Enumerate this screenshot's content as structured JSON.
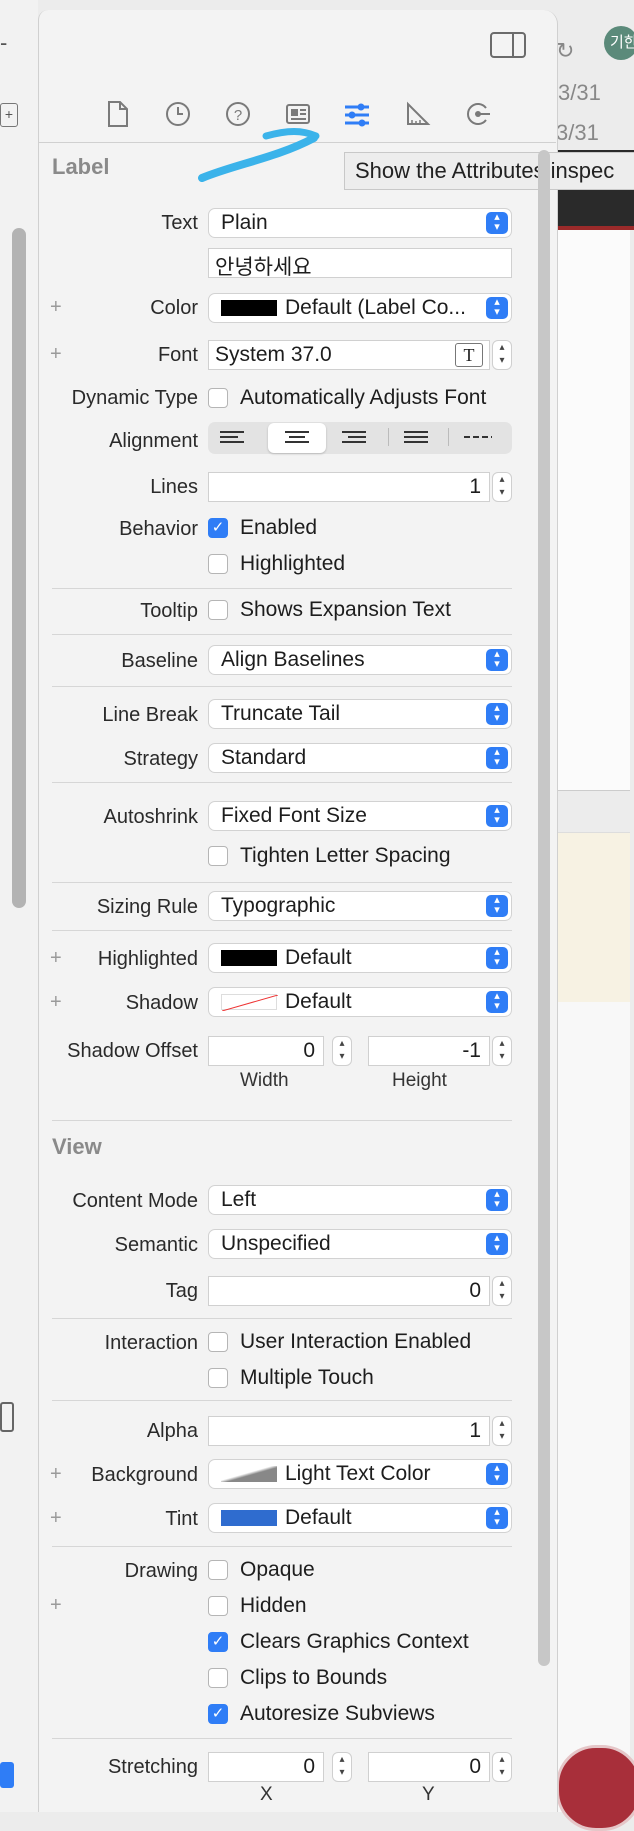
{
  "toolbar_right": {
    "avatar_text": "기한",
    "partial_text_1": "3/31",
    "partial_text_2": "3/31"
  },
  "tooltip": "Show the Attributes inspec",
  "label_section": {
    "title": "Label",
    "text_label": "Text",
    "text_value": "Plain",
    "text_content": "안녕하세요",
    "color_label": "Color",
    "color_value": "Default (Label Co...",
    "font_label": "Font",
    "font_value": "System 37.0",
    "dynamic_type_label": "Dynamic Type",
    "dynamic_type_option": "Automatically Adjusts Font",
    "alignment_label": "Alignment",
    "lines_label": "Lines",
    "lines_value": "1",
    "behavior_label": "Behavior",
    "enabled": "Enabled",
    "highlighted": "Highlighted",
    "tooltip_label": "Tooltip",
    "tooltip_option": "Shows Expansion Text",
    "baseline_label": "Baseline",
    "baseline_value": "Align Baselines",
    "linebreak_label": "Line Break",
    "linebreak_value": "Truncate Tail",
    "strategy_label": "Strategy",
    "strategy_value": "Standard",
    "autoshrink_label": "Autoshrink",
    "autoshrink_value": "Fixed Font Size",
    "tighten": "Tighten Letter Spacing",
    "sizing_label": "Sizing Rule",
    "sizing_value": "Typographic",
    "highlighted_label": "Highlighted",
    "highlighted_value": "Default",
    "shadow_label": "Shadow",
    "shadow_value": "Default",
    "shadow_offset_label": "Shadow Offset",
    "width_value": "0",
    "height_value": "-1",
    "width_caption": "Width",
    "height_caption": "Height"
  },
  "view_section": {
    "title": "View",
    "content_mode_label": "Content Mode",
    "content_mode_value": "Left",
    "semantic_label": "Semantic",
    "semantic_value": "Unspecified",
    "tag_label": "Tag",
    "tag_value": "0",
    "interaction_label": "Interaction",
    "user_interaction": "User Interaction Enabled",
    "multiple_touch": "Multiple Touch",
    "alpha_label": "Alpha",
    "alpha_value": "1",
    "background_label": "Background",
    "background_value": "Light Text Color",
    "tint_label": "Tint",
    "tint_value": "Default",
    "drawing_label": "Drawing",
    "opaque": "Opaque",
    "hidden": "Hidden",
    "clears": "Clears Graphics Context",
    "clips": "Clips to Bounds",
    "autoresize": "Autoresize Subviews",
    "stretching_label": "Stretching",
    "x_value": "0",
    "y_value": "0",
    "x_caption": "X",
    "y_caption": "Y"
  },
  "colors": {
    "accent": "#2f7df6",
    "annotation": "#3bb3ea"
  }
}
